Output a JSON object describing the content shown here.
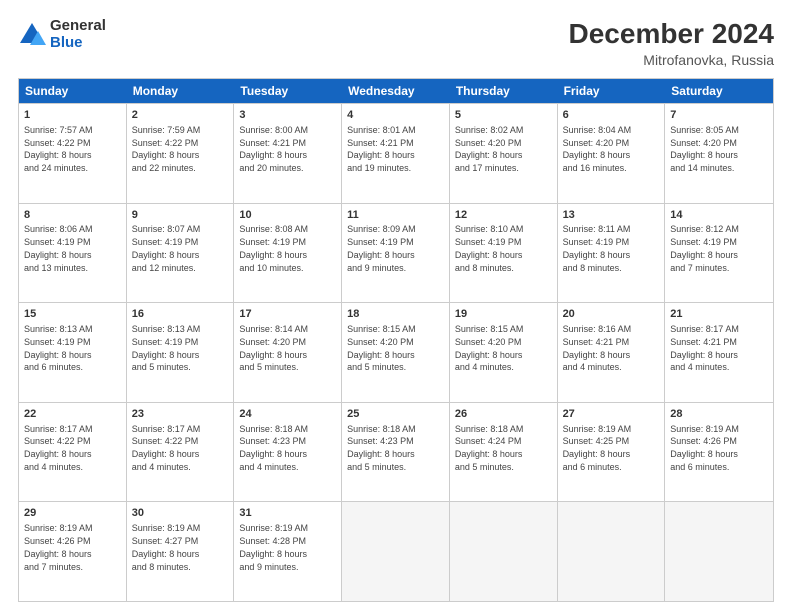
{
  "logo": {
    "general": "General",
    "blue": "Blue"
  },
  "title": "December 2024",
  "subtitle": "Mitrofanovka, Russia",
  "days": [
    "Sunday",
    "Monday",
    "Tuesday",
    "Wednesday",
    "Thursday",
    "Friday",
    "Saturday"
  ],
  "weeks": [
    [
      {
        "day": 1,
        "lines": [
          "Sunrise: 7:57 AM",
          "Sunset: 4:22 PM",
          "Daylight: 8 hours",
          "and 24 minutes."
        ]
      },
      {
        "day": 2,
        "lines": [
          "Sunrise: 7:59 AM",
          "Sunset: 4:22 PM",
          "Daylight: 8 hours",
          "and 22 minutes."
        ]
      },
      {
        "day": 3,
        "lines": [
          "Sunrise: 8:00 AM",
          "Sunset: 4:21 PM",
          "Daylight: 8 hours",
          "and 20 minutes."
        ]
      },
      {
        "day": 4,
        "lines": [
          "Sunrise: 8:01 AM",
          "Sunset: 4:21 PM",
          "Daylight: 8 hours",
          "and 19 minutes."
        ]
      },
      {
        "day": 5,
        "lines": [
          "Sunrise: 8:02 AM",
          "Sunset: 4:20 PM",
          "Daylight: 8 hours",
          "and 17 minutes."
        ]
      },
      {
        "day": 6,
        "lines": [
          "Sunrise: 8:04 AM",
          "Sunset: 4:20 PM",
          "Daylight: 8 hours",
          "and 16 minutes."
        ]
      },
      {
        "day": 7,
        "lines": [
          "Sunrise: 8:05 AM",
          "Sunset: 4:20 PM",
          "Daylight: 8 hours",
          "and 14 minutes."
        ]
      }
    ],
    [
      {
        "day": 8,
        "lines": [
          "Sunrise: 8:06 AM",
          "Sunset: 4:19 PM",
          "Daylight: 8 hours",
          "and 13 minutes."
        ]
      },
      {
        "day": 9,
        "lines": [
          "Sunrise: 8:07 AM",
          "Sunset: 4:19 PM",
          "Daylight: 8 hours",
          "and 12 minutes."
        ]
      },
      {
        "day": 10,
        "lines": [
          "Sunrise: 8:08 AM",
          "Sunset: 4:19 PM",
          "Daylight: 8 hours",
          "and 10 minutes."
        ]
      },
      {
        "day": 11,
        "lines": [
          "Sunrise: 8:09 AM",
          "Sunset: 4:19 PM",
          "Daylight: 8 hours",
          "and 9 minutes."
        ]
      },
      {
        "day": 12,
        "lines": [
          "Sunrise: 8:10 AM",
          "Sunset: 4:19 PM",
          "Daylight: 8 hours",
          "and 8 minutes."
        ]
      },
      {
        "day": 13,
        "lines": [
          "Sunrise: 8:11 AM",
          "Sunset: 4:19 PM",
          "Daylight: 8 hours",
          "and 8 minutes."
        ]
      },
      {
        "day": 14,
        "lines": [
          "Sunrise: 8:12 AM",
          "Sunset: 4:19 PM",
          "Daylight: 8 hours",
          "and 7 minutes."
        ]
      }
    ],
    [
      {
        "day": 15,
        "lines": [
          "Sunrise: 8:13 AM",
          "Sunset: 4:19 PM",
          "Daylight: 8 hours",
          "and 6 minutes."
        ]
      },
      {
        "day": 16,
        "lines": [
          "Sunrise: 8:13 AM",
          "Sunset: 4:19 PM",
          "Daylight: 8 hours",
          "and 5 minutes."
        ]
      },
      {
        "day": 17,
        "lines": [
          "Sunrise: 8:14 AM",
          "Sunset: 4:20 PM",
          "Daylight: 8 hours",
          "and 5 minutes."
        ]
      },
      {
        "day": 18,
        "lines": [
          "Sunrise: 8:15 AM",
          "Sunset: 4:20 PM",
          "Daylight: 8 hours",
          "and 5 minutes."
        ]
      },
      {
        "day": 19,
        "lines": [
          "Sunrise: 8:15 AM",
          "Sunset: 4:20 PM",
          "Daylight: 8 hours",
          "and 4 minutes."
        ]
      },
      {
        "day": 20,
        "lines": [
          "Sunrise: 8:16 AM",
          "Sunset: 4:21 PM",
          "Daylight: 8 hours",
          "and 4 minutes."
        ]
      },
      {
        "day": 21,
        "lines": [
          "Sunrise: 8:17 AM",
          "Sunset: 4:21 PM",
          "Daylight: 8 hours",
          "and 4 minutes."
        ]
      }
    ],
    [
      {
        "day": 22,
        "lines": [
          "Sunrise: 8:17 AM",
          "Sunset: 4:22 PM",
          "Daylight: 8 hours",
          "and 4 minutes."
        ]
      },
      {
        "day": 23,
        "lines": [
          "Sunrise: 8:17 AM",
          "Sunset: 4:22 PM",
          "Daylight: 8 hours",
          "and 4 minutes."
        ]
      },
      {
        "day": 24,
        "lines": [
          "Sunrise: 8:18 AM",
          "Sunset: 4:23 PM",
          "Daylight: 8 hours",
          "and 4 minutes."
        ]
      },
      {
        "day": 25,
        "lines": [
          "Sunrise: 8:18 AM",
          "Sunset: 4:23 PM",
          "Daylight: 8 hours",
          "and 5 minutes."
        ]
      },
      {
        "day": 26,
        "lines": [
          "Sunrise: 8:18 AM",
          "Sunset: 4:24 PM",
          "Daylight: 8 hours",
          "and 5 minutes."
        ]
      },
      {
        "day": 27,
        "lines": [
          "Sunrise: 8:19 AM",
          "Sunset: 4:25 PM",
          "Daylight: 8 hours",
          "and 6 minutes."
        ]
      },
      {
        "day": 28,
        "lines": [
          "Sunrise: 8:19 AM",
          "Sunset: 4:26 PM",
          "Daylight: 8 hours",
          "and 6 minutes."
        ]
      }
    ],
    [
      {
        "day": 29,
        "lines": [
          "Sunrise: 8:19 AM",
          "Sunset: 4:26 PM",
          "Daylight: 8 hours",
          "and 7 minutes."
        ]
      },
      {
        "day": 30,
        "lines": [
          "Sunrise: 8:19 AM",
          "Sunset: 4:27 PM",
          "Daylight: 8 hours",
          "and 8 minutes."
        ]
      },
      {
        "day": 31,
        "lines": [
          "Sunrise: 8:19 AM",
          "Sunset: 4:28 PM",
          "Daylight: 8 hours",
          "and 9 minutes."
        ]
      },
      null,
      null,
      null,
      null
    ]
  ]
}
